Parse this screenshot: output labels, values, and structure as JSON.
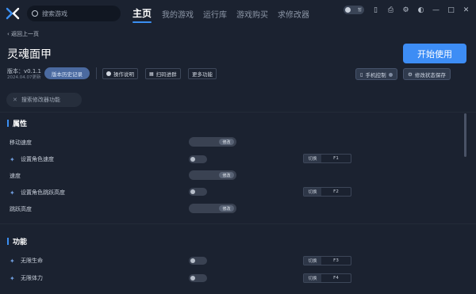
{
  "topbar": {
    "search_placeholder": "搜索游戏",
    "tabs": [
      {
        "label": "主页",
        "active": true
      },
      {
        "label": "我的游戏",
        "active": false
      },
      {
        "label": "运行库",
        "active": false
      },
      {
        "label": "游戏购买",
        "active": false
      },
      {
        "label": "求修改器",
        "active": false
      }
    ],
    "toggle_text": "暂"
  },
  "header": {
    "back_label": "返回上一页",
    "game_title": "灵魂面甲",
    "start_button": "开始使用",
    "version_label": "版本：v0.1.1",
    "version_date": "2024.04.07更新",
    "history_button": "版本历史记录",
    "buttons": {
      "instructions": "操作说明",
      "scan_qr": "扫码进群",
      "more": "更多功能"
    },
    "mobile_control": "手机控制",
    "save_state": "修改状态保存"
  },
  "feature_search_placeholder": "搜索修改器功能",
  "sections": {
    "attributes": {
      "title": "属性",
      "rows": [
        {
          "label": "移动速度",
          "control": "slider",
          "button": "修改"
        },
        {
          "label": "设置角色速度",
          "control": "switch",
          "hotkey_action": "切换",
          "hotkey": "F1"
        },
        {
          "label": "速度",
          "control": "slider",
          "button": "修改"
        },
        {
          "label": "设置角色跳跃高度",
          "control": "switch",
          "hotkey_action": "切换",
          "hotkey": "F2"
        },
        {
          "label": "跳跃高度",
          "control": "slider",
          "button": "修改"
        }
      ]
    },
    "functions": {
      "title": "功能",
      "rows": [
        {
          "label": "无限生命",
          "control": "switch",
          "hotkey_action": "切换",
          "hotkey": "F3"
        },
        {
          "label": "无限体力",
          "control": "switch",
          "hotkey_action": "切换",
          "hotkey": "F4"
        }
      ]
    }
  },
  "colors": {
    "background": "#1b2230",
    "accent": "#3d8df5",
    "history_button": "#4b6aa0"
  }
}
